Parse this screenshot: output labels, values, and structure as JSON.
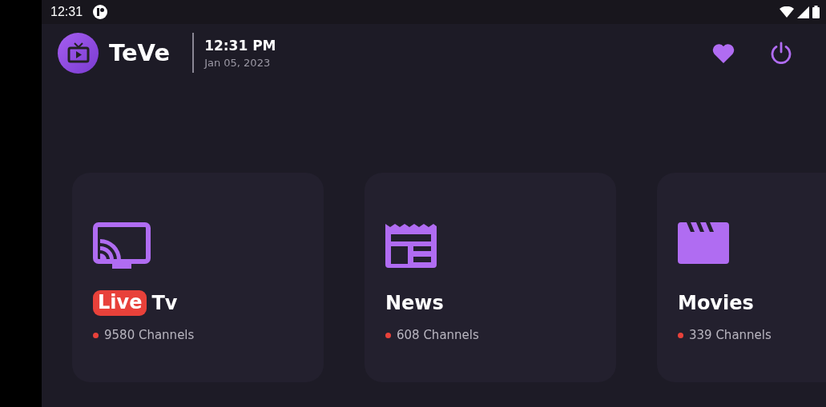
{
  "status_bar": {
    "time": "12:31"
  },
  "header": {
    "app_name": "TeVe",
    "time": "12:31 PM",
    "date": "Jan 05, 2023"
  },
  "categories": [
    {
      "badge": "Live",
      "title": "Tv",
      "count": "9580 Channels"
    },
    {
      "title": "News",
      "count": "608 Channels"
    },
    {
      "title": "Movies",
      "count": "339 Channels"
    }
  ]
}
